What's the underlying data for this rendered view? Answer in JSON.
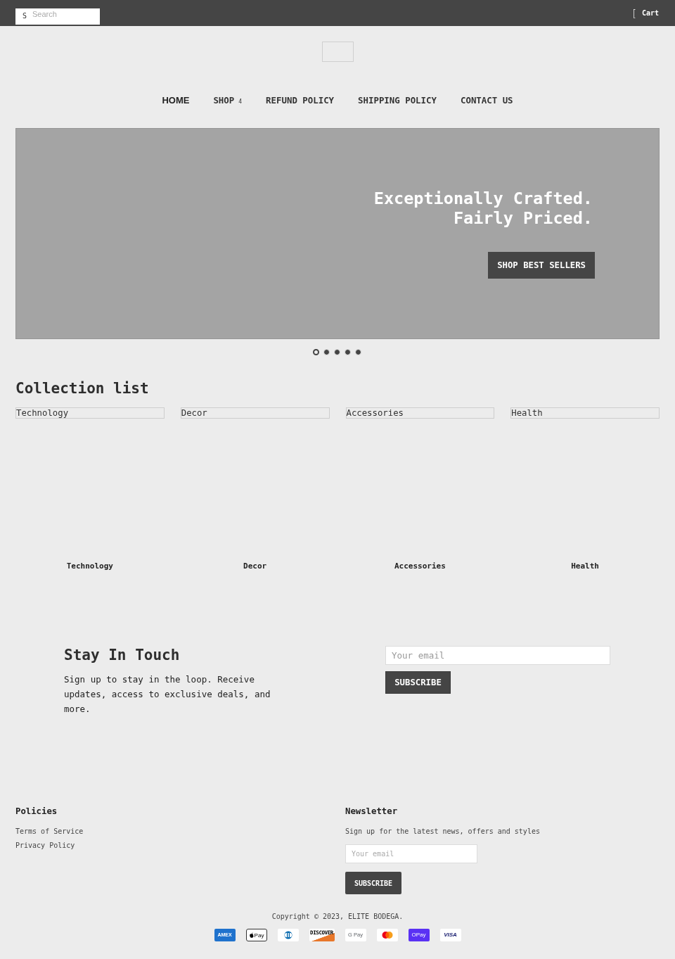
{
  "top_bar": {
    "search": {
      "icon_glyph": "S",
      "placeholder": "Search"
    },
    "cart": {
      "icon_glyph": "[",
      "label": "Cart"
    }
  },
  "nav": [
    {
      "label": "HOME",
      "selected": true
    },
    {
      "label": "SHOP",
      "caret_glyph": "4",
      "selected": false
    },
    {
      "label": "REFUND POLICY",
      "selected": false
    },
    {
      "label": "SHIPPING POLICY",
      "selected": false
    },
    {
      "label": "CONTACT US",
      "selected": false
    }
  ],
  "hero": {
    "heading_lines": [
      "Exceptionally Crafted.",
      "Fairly Priced."
    ],
    "button": "SHOP BEST SELLERS",
    "slides": [
      {
        "selected": true
      },
      {
        "selected": false
      },
      {
        "selected": false
      },
      {
        "selected": false
      },
      {
        "selected": false
      }
    ]
  },
  "collection": {
    "title": "Collection list",
    "items": [
      {
        "image_alt": "Technology",
        "label": "Technology"
      },
      {
        "image_alt": "Decor",
        "label": "Decor"
      },
      {
        "image_alt": "Accessories",
        "label": "Accessories"
      },
      {
        "image_alt": "Health",
        "label": "Health"
      }
    ]
  },
  "stay_in_touch": {
    "title": "Stay In Touch",
    "text": "Sign up to stay in the loop. Receive updates, access to exclusive deals, and more.",
    "email_placeholder": "Your email",
    "button": "SUBSCRIBE"
  },
  "footer": {
    "policies": {
      "title": "Policies",
      "links": [
        "Terms of Service",
        "Privacy Policy"
      ]
    },
    "newsletter": {
      "title": "Newsletter",
      "text": "Sign up for the latest news, offers and styles",
      "email_placeholder": "Your email",
      "button": "SUBSCRIBE"
    },
    "copyright": "Copyright © 2023, ELITE BODEGA.",
    "payment_methods": [
      {
        "kind": "amex",
        "label": "AMEX"
      },
      {
        "kind": "apple_pay",
        "label": "Pay"
      },
      {
        "kind": "diners"
      },
      {
        "kind": "discover",
        "label": "DISCOVER"
      },
      {
        "kind": "google_pay",
        "label": "G Pay"
      },
      {
        "kind": "mastercard"
      },
      {
        "kind": "shop_pay",
        "label": "OPay"
      },
      {
        "kind": "visa",
        "label": "VISA"
      }
    ]
  }
}
